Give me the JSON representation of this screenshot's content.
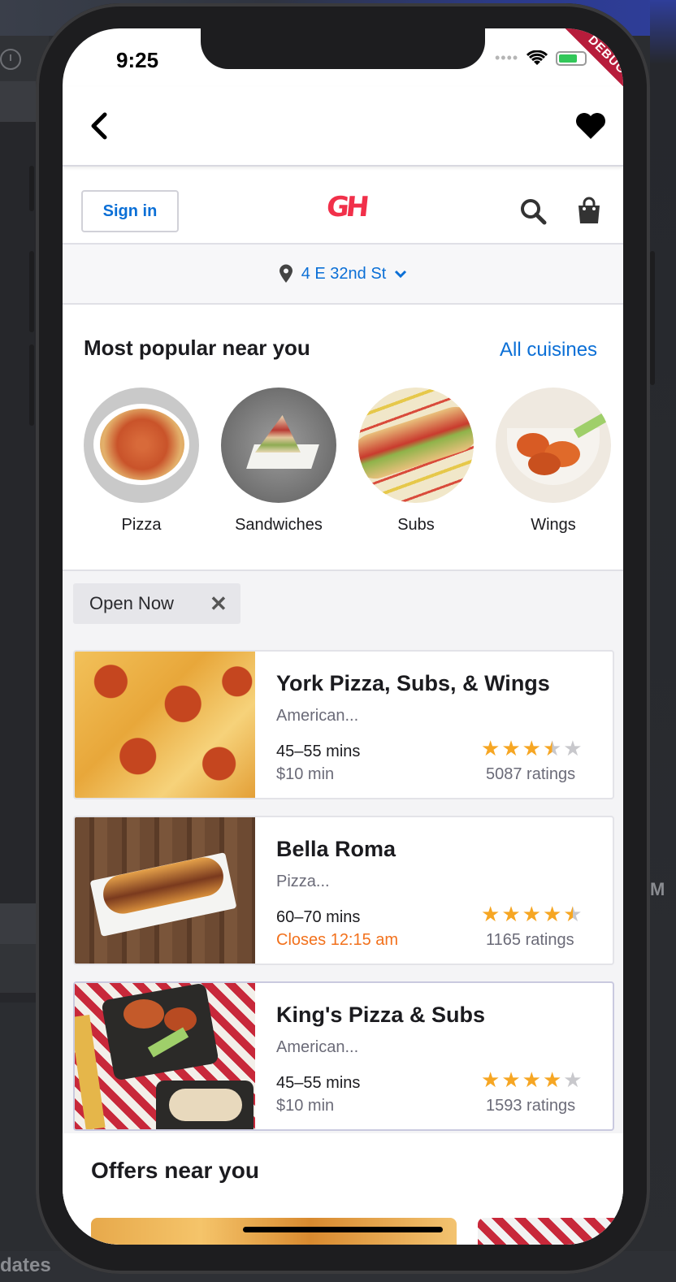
{
  "status_bar": {
    "time": "9:25",
    "debug_banner": "DEBUG"
  },
  "app_bar": {
    "back_icon": "chevron-left-icon",
    "favorite_icon": "heart-icon"
  },
  "header": {
    "sign_in_label": "Sign in",
    "logo_text": "GH",
    "brand_color": "#f1304a"
  },
  "address": {
    "text": "4 E 32nd St"
  },
  "popular": {
    "title": "Most popular near you",
    "all_link": "All cuisines",
    "items": [
      {
        "label": "Pizza"
      },
      {
        "label": "Sandwiches"
      },
      {
        "label": "Subs"
      },
      {
        "label": "Wings"
      }
    ]
  },
  "filter": {
    "chip_label": "Open Now",
    "remove_icon": "close-icon"
  },
  "restaurants": [
    {
      "name": "York Pizza, Subs, & Wings",
      "cuisine": "American...",
      "time": "45–55 mins",
      "min": "$10 min",
      "rating": 3.5,
      "ratings": "5087 ratings"
    },
    {
      "name": "Bella Roma",
      "cuisine": "Pizza...",
      "time": "60–70 mins",
      "min": "Closes 12:15 am",
      "rating": 4.5,
      "ratings": "1165 ratings"
    },
    {
      "name": "King's Pizza & Subs",
      "cuisine": "American...",
      "time": "45–55 mins",
      "min": "$10 min",
      "rating": 4,
      "ratings": "1593 ratings"
    }
  ],
  "offers": {
    "title": "Offers near you"
  },
  "colors": {
    "accent": "#0b6fd6",
    "star": "#f6a623",
    "warning": "#f2711c"
  },
  "desktop": {
    "bottom_text": "dates",
    "right_letter": "M"
  }
}
